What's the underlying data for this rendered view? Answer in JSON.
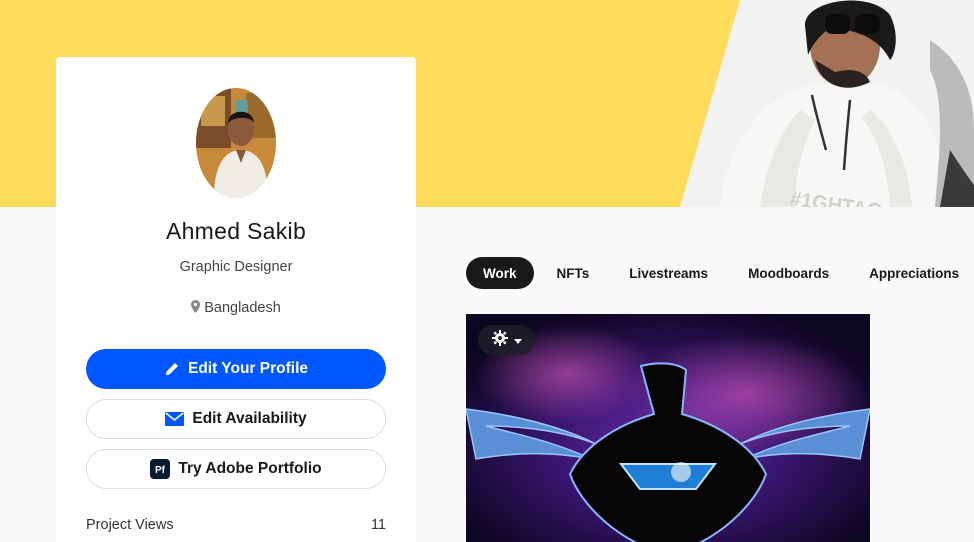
{
  "profile": {
    "name": "Ahmed Sakib",
    "occupation": "Graphic Designer",
    "location": "Bangladesh"
  },
  "actions": {
    "edit_profile": "Edit Your Profile",
    "edit_availability": "Edit Availability",
    "adobe_portfolio": "Try Adobe Portfolio",
    "adobe_badge": "Pf"
  },
  "stats": {
    "project_views_label": "Project Views",
    "project_views_value": "11"
  },
  "tabs": [
    {
      "label": "Work",
      "active": true
    },
    {
      "label": "NFTs"
    },
    {
      "label": "Livestreams"
    },
    {
      "label": "Moodboards"
    },
    {
      "label": "Appreciations"
    }
  ],
  "colors": {
    "banner": "#fddc5c",
    "primary": "#0057ff",
    "dark": "#191919"
  },
  "icons": {
    "edit": "pencil-icon",
    "availability": "mail-icon",
    "location": "pin-icon",
    "settings": "gear-icon",
    "dropdown": "caret-down-icon"
  }
}
